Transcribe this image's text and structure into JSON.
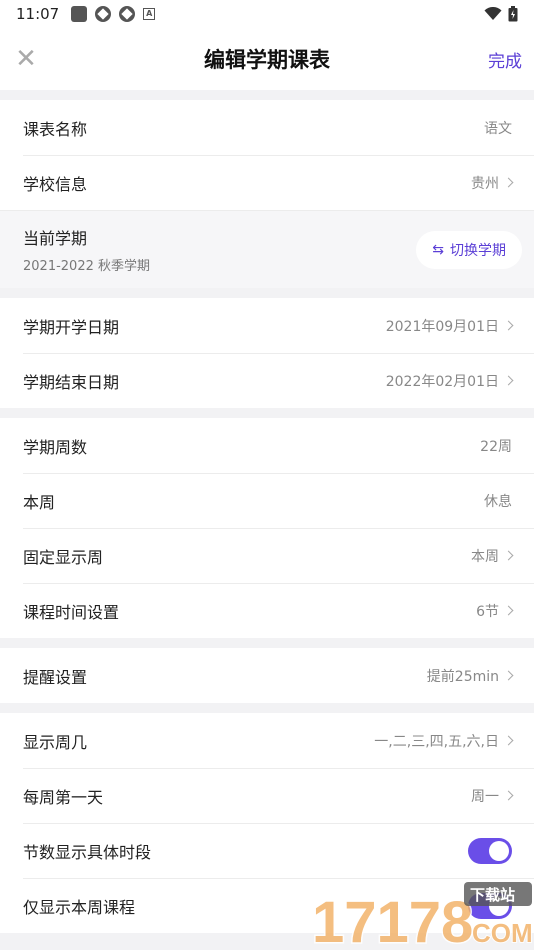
{
  "status_bar": {
    "time": "11:07"
  },
  "header": {
    "title": "编辑学期课表",
    "done_label": "完成",
    "close_glyph": "✕"
  },
  "groups": [
    {
      "rows": [
        {
          "label": "课表名称",
          "value": "语文",
          "chevron": false
        },
        {
          "label": "学校信息",
          "value": "贵州",
          "chevron": true
        }
      ]
    },
    {
      "term": {
        "label": "当前学期",
        "sub": "2021-2022 秋季学期",
        "switch_label": "切换学期",
        "switch_glyph": "⇆"
      }
    },
    {
      "rows": [
        {
          "label": "学期开学日期",
          "value": "2021年09月01日",
          "chevron": true
        },
        {
          "label": "学期结束日期",
          "value": "2022年02月01日",
          "chevron": true
        }
      ]
    },
    {
      "rows": [
        {
          "label": "学期周数",
          "value": "22周",
          "chevron": false
        },
        {
          "label": "本周",
          "value": "休息",
          "chevron": false
        },
        {
          "label": "固定显示周",
          "value": "本周",
          "chevron": true
        },
        {
          "label": "课程时间设置",
          "value": "6节",
          "chevron": true
        }
      ]
    },
    {
      "rows": [
        {
          "label": "提醒设置",
          "value": "提前25min",
          "chevron": true
        }
      ]
    },
    {
      "rows": [
        {
          "label": "显示周几",
          "value": "一,二,三,四,五,六,日",
          "chevron": true
        },
        {
          "label": "每周第一天",
          "value": "周一",
          "chevron": true
        },
        {
          "label": "节数显示具体时段",
          "toggle": true,
          "on": true
        },
        {
          "label": "仅显示本周课程",
          "toggle": true,
          "on": true
        }
      ]
    }
  ],
  "watermark": {
    "text": "17178",
    "tag": "下载站",
    "sub": "COM"
  },
  "colors": {
    "accent": "#5b3fd6",
    "toggle_on": "#6a4ee8",
    "background": "#f2f2f4"
  }
}
